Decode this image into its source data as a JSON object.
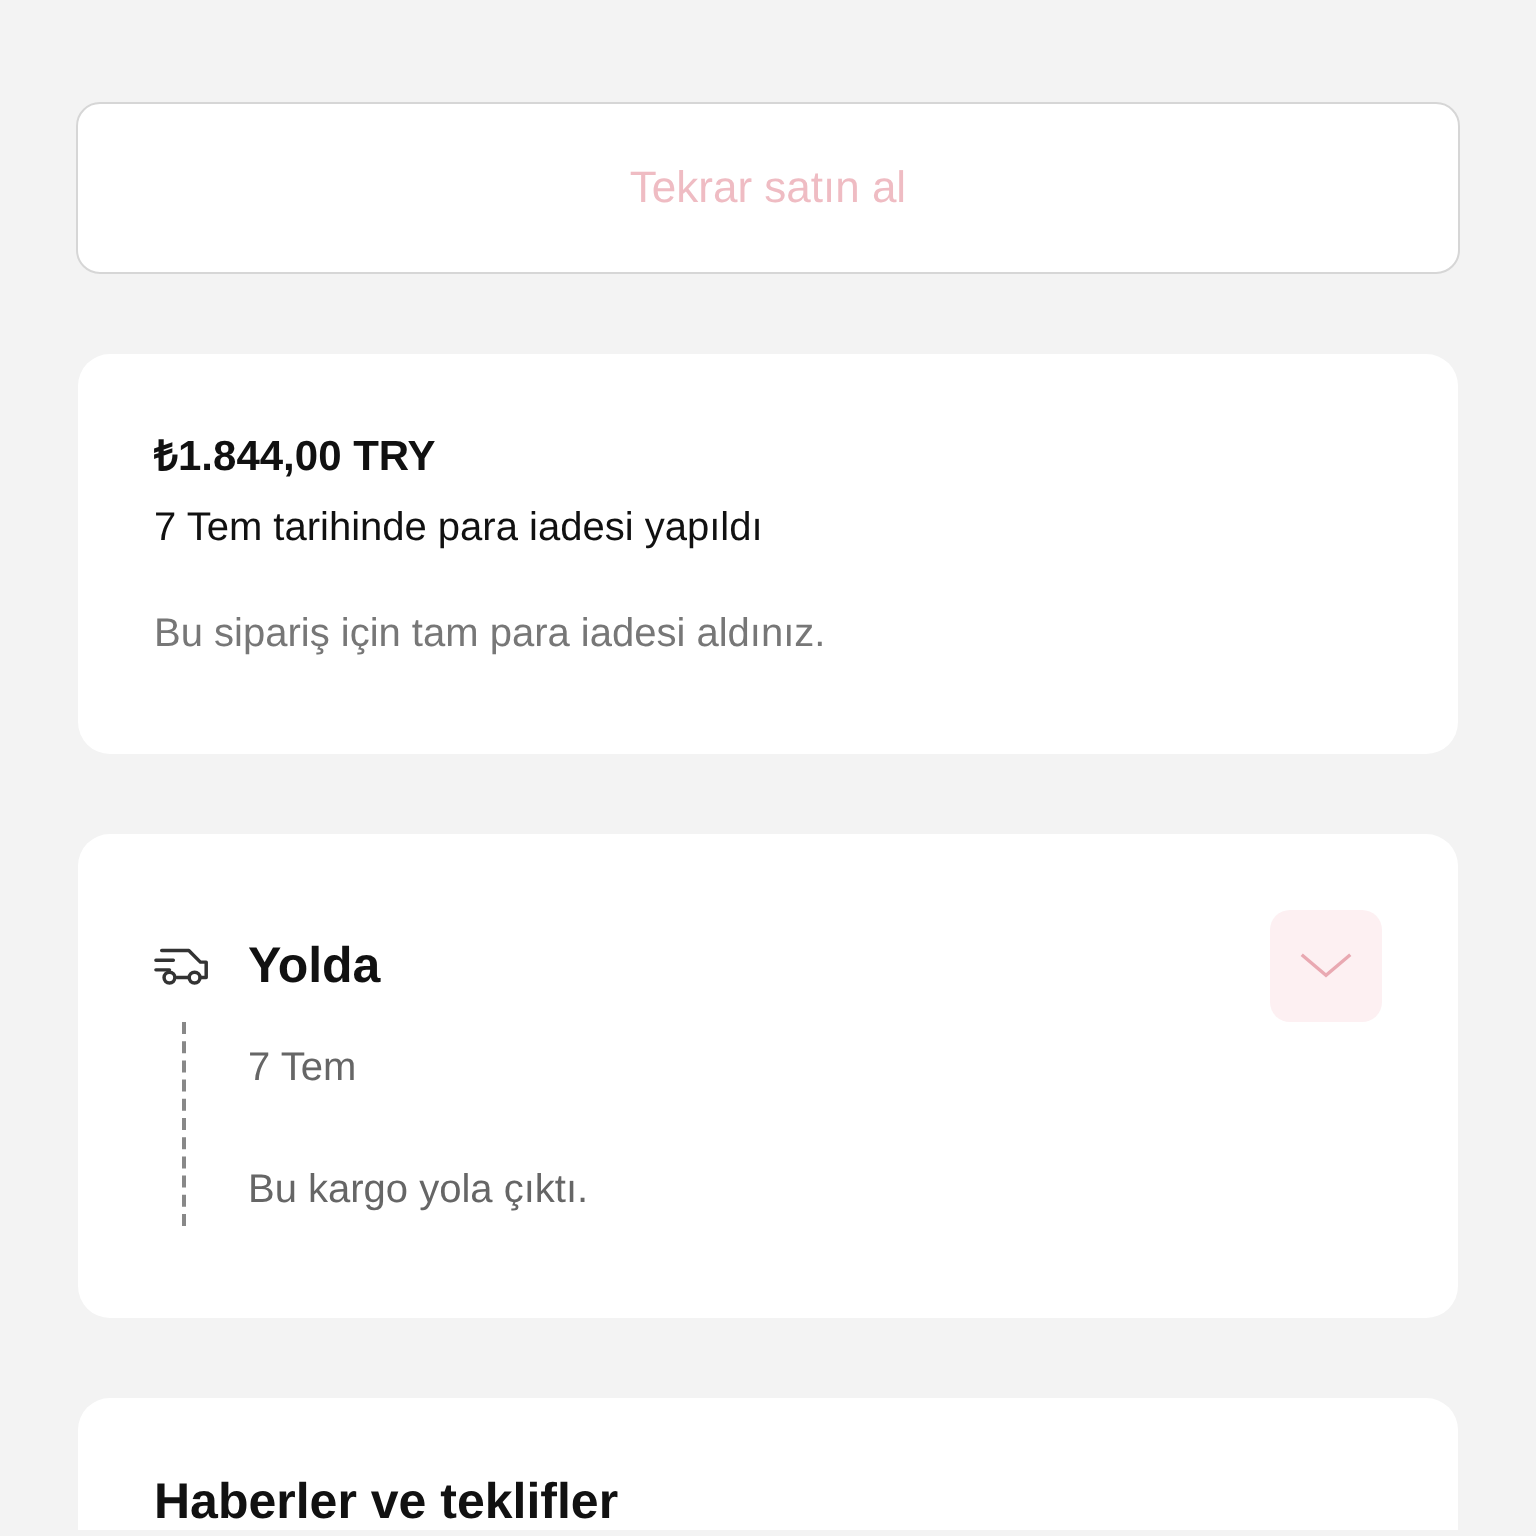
{
  "rebuy_button": {
    "label": "Tekrar satın al",
    "disabled": true
  },
  "refund": {
    "amount": "₺1.844,00 TRY",
    "status": "7 Tem tarihinde para iadesi yapıldı",
    "note": "Bu sipariş için tam para iadesi aldınız."
  },
  "tracking": {
    "title": "Yolda",
    "expanded": false,
    "events": [
      {
        "date": "7 Tem",
        "description": "Bu kargo yola çıktı."
      }
    ]
  },
  "news": {
    "title": "Haberler ve teklifler"
  }
}
